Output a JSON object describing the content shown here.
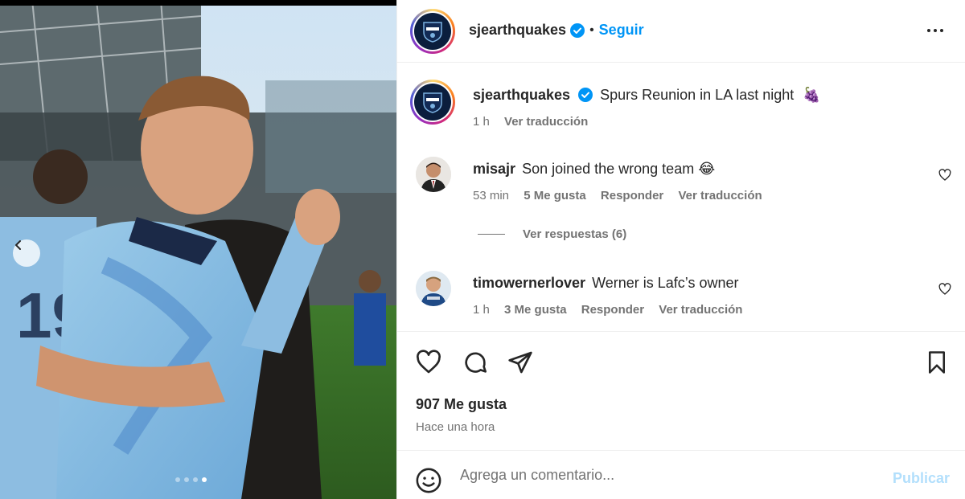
{
  "post": {
    "author": "sjearthquakes",
    "follow_label": "Seguir",
    "separator": "•",
    "caption_text": "Spurs Reunion in LA last night",
    "caption_emoji": "🍇",
    "caption_time": "1 h",
    "caption_translate": "Ver traducción"
  },
  "comments": [
    {
      "username": "misajr",
      "text": "Son joined the wrong team 😂",
      "time": "53 min",
      "likes": "5 Me gusta",
      "reply": "Responder",
      "translate": "Ver traducción",
      "replies_label": "Ver respuestas (6)"
    },
    {
      "username": "timowernerlover",
      "text": "Werner is Lafc’s owner",
      "time": "1 h",
      "likes": "3 Me gusta",
      "reply": "Responder",
      "translate": "Ver traducción"
    }
  ],
  "footer": {
    "likes_count": "907 Me gusta",
    "posted_time": "Hace una hora",
    "comment_placeholder": "Agrega un comentario...",
    "publish_label": "Publicar"
  },
  "icons": {
    "verified": "verified-badge-icon",
    "more": "more-options-icon",
    "like": "heart-icon",
    "comment": "comment-bubble-icon",
    "share": "share-paper-plane-icon",
    "save": "bookmark-icon",
    "emoji": "emoji-smiley-icon",
    "prev": "chevron-left-icon"
  },
  "carousel": {
    "slides": 4,
    "active_index": 3
  },
  "colors": {
    "link_blue": "#0095f6",
    "publish_disabled": "#b2dffc",
    "muted": "#737373",
    "verified_blue": "#0095f6"
  }
}
